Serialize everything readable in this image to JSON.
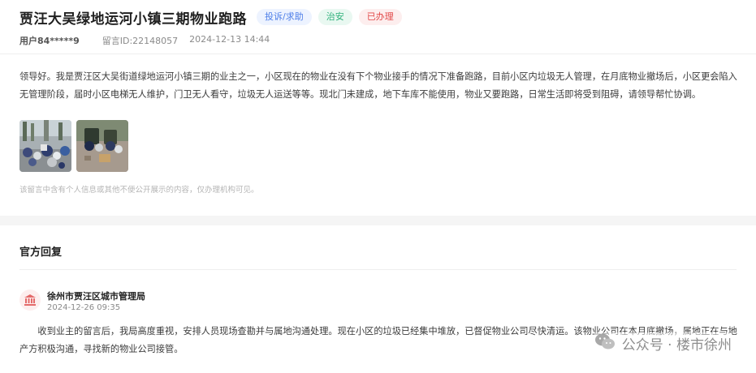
{
  "header": {
    "title": "贾汪大吴绿地运河小镇三期物业跑路",
    "tags": [
      {
        "label": "投诉/求助",
        "color": "#4d7ee8"
      },
      {
        "label": "治安",
        "color": "#2fb17b"
      },
      {
        "label": "已办理",
        "color": "#e24848"
      }
    ]
  },
  "meta": {
    "user": "用户84*****9",
    "message_id": "留言ID:22148057",
    "datetime": "2024-12-13 14:44"
  },
  "message": {
    "body": "领导好。我是贾汪区大吴街道绿地运河小镇三期的业主之一，小区现在的物业在没有下个物业接手的情况下准备跑路，目前小区内垃圾无人管理，在月底物业撤场后，小区更会陷入无管理阶段，届时小区电梯无人维护，门卫无人看守，垃圾无人运送等等。现北门未建成，地下车库不能使用，物业又要跑路，日常生活即将受到阻碍，请领导帮忙协调。",
    "images": [
      {
        "name": "garbage-photo-1"
      },
      {
        "name": "garbage-photo-2"
      }
    ],
    "privacy_note": "该留言中含有个人信息或其他不便公开展示的内容，仅办理机构可见。"
  },
  "reply": {
    "section_title": "官方回复",
    "org_name": "徐州市贾汪区城市管理局",
    "date": "2024-12-26 09:35",
    "body": "收到业主的留言后，我局高度重视，安排人员现场查勘并与属地沟通处理。现在小区的垃圾已经集中堆放，已督促物业公司尽快清运。该物业公司在本月底撤场，属地正在与地产方积极沟通，寻找新的物业公司接管。"
  },
  "watermark": {
    "text": "公众号 · 楼市徐州",
    "icon": "wechat-icon"
  }
}
